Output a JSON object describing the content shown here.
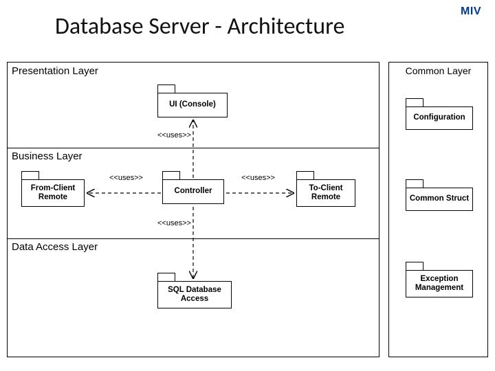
{
  "brand": "MIV",
  "title": "Database Server - Architecture",
  "layers": {
    "presentation": "Presentation Layer",
    "business": "Business Layer",
    "data": "Data Access Layer",
    "common": "Common Layer"
  },
  "packages": {
    "ui": "UI (Console)",
    "from_client": "From-Client Remote",
    "controller": "Controller",
    "to_client": "To-Client Remote",
    "sql": "SQL Database Access",
    "config": "Configuration",
    "common_struct": "Common Struct",
    "exception": "Exception Management"
  },
  "labels": {
    "uses": "<<uses>>"
  }
}
